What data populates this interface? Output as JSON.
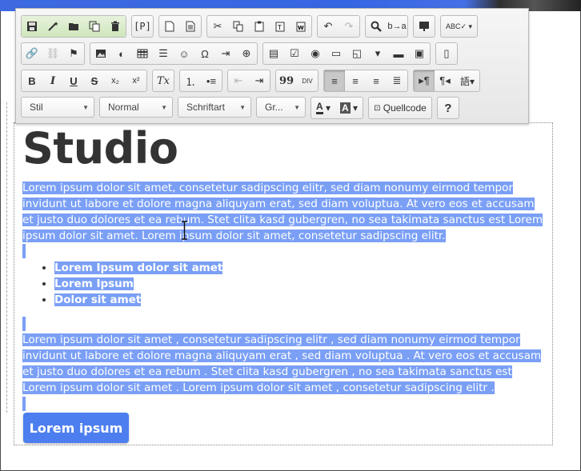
{
  "toolbar": {
    "row1": [
      "save-icon",
      "magic-wand-icon",
      "folder-icon",
      "copy-doc-icon",
      "trash-icon",
      "P",
      "new-doc-icon",
      "doc-icon",
      "cut-icon",
      "copy-icon",
      "paste-icon",
      "paste-text-icon",
      "paste-word-icon",
      "undo-icon",
      "redo-icon",
      "find-icon",
      "replace-icon",
      "templates-icon",
      "ABC"
    ],
    "row3_text": {
      "bold": "B",
      "italic": "I",
      "underline": "U",
      "strike": "S",
      "sub": "x₂",
      "sup": "x²",
      "clear": "Tx",
      "quote": "99",
      "div": "DIV"
    },
    "combos": {
      "style": "Stil",
      "format": "Normal",
      "font": "Schriftart",
      "size": "Gr...",
      "source": "Quellcode",
      "help": "?"
    }
  },
  "content": {
    "heading": "Studio",
    "para1": "Lorem ipsum dolor sit amet, consetetur sadipscing elitr, sed diam nonumy eirmod tempor invidunt ut labore et dolore magna aliquyam erat, sed diam voluptua. At vero eos et accusam et justo duo dolores et ea rebum. Stet clita kasd gubergren, no sea takimata sanctus est Lorem ipsum dolor sit amet. Lorem ipsum dolor sit amet, consetetur sadipscing elitr.",
    "list": [
      "Lorem Ipsum dolor sit amet",
      "Lorem Ipsum",
      "Dolor sit amet"
    ],
    "para2": "Lorem ipsum dolor sit amet , consetetur sadipscing elitr , sed diam nonumy eirmod tempor invidunt ut labore et dolore magna aliquyam erat , sed diam voluptua . At vero eos et accusam et justo duo dolores et ea rebum . Stet clita kasd gubergren , no sea takimata sanctus est Lorem ipsum dolor sit amet . Lorem ipsum dolor sit amet , consetetur sadipscing elitr .",
    "button": "Lorem ipsum"
  },
  "colors": {
    "selection": "#7a9ff5",
    "button": "#4d7ef0"
  }
}
